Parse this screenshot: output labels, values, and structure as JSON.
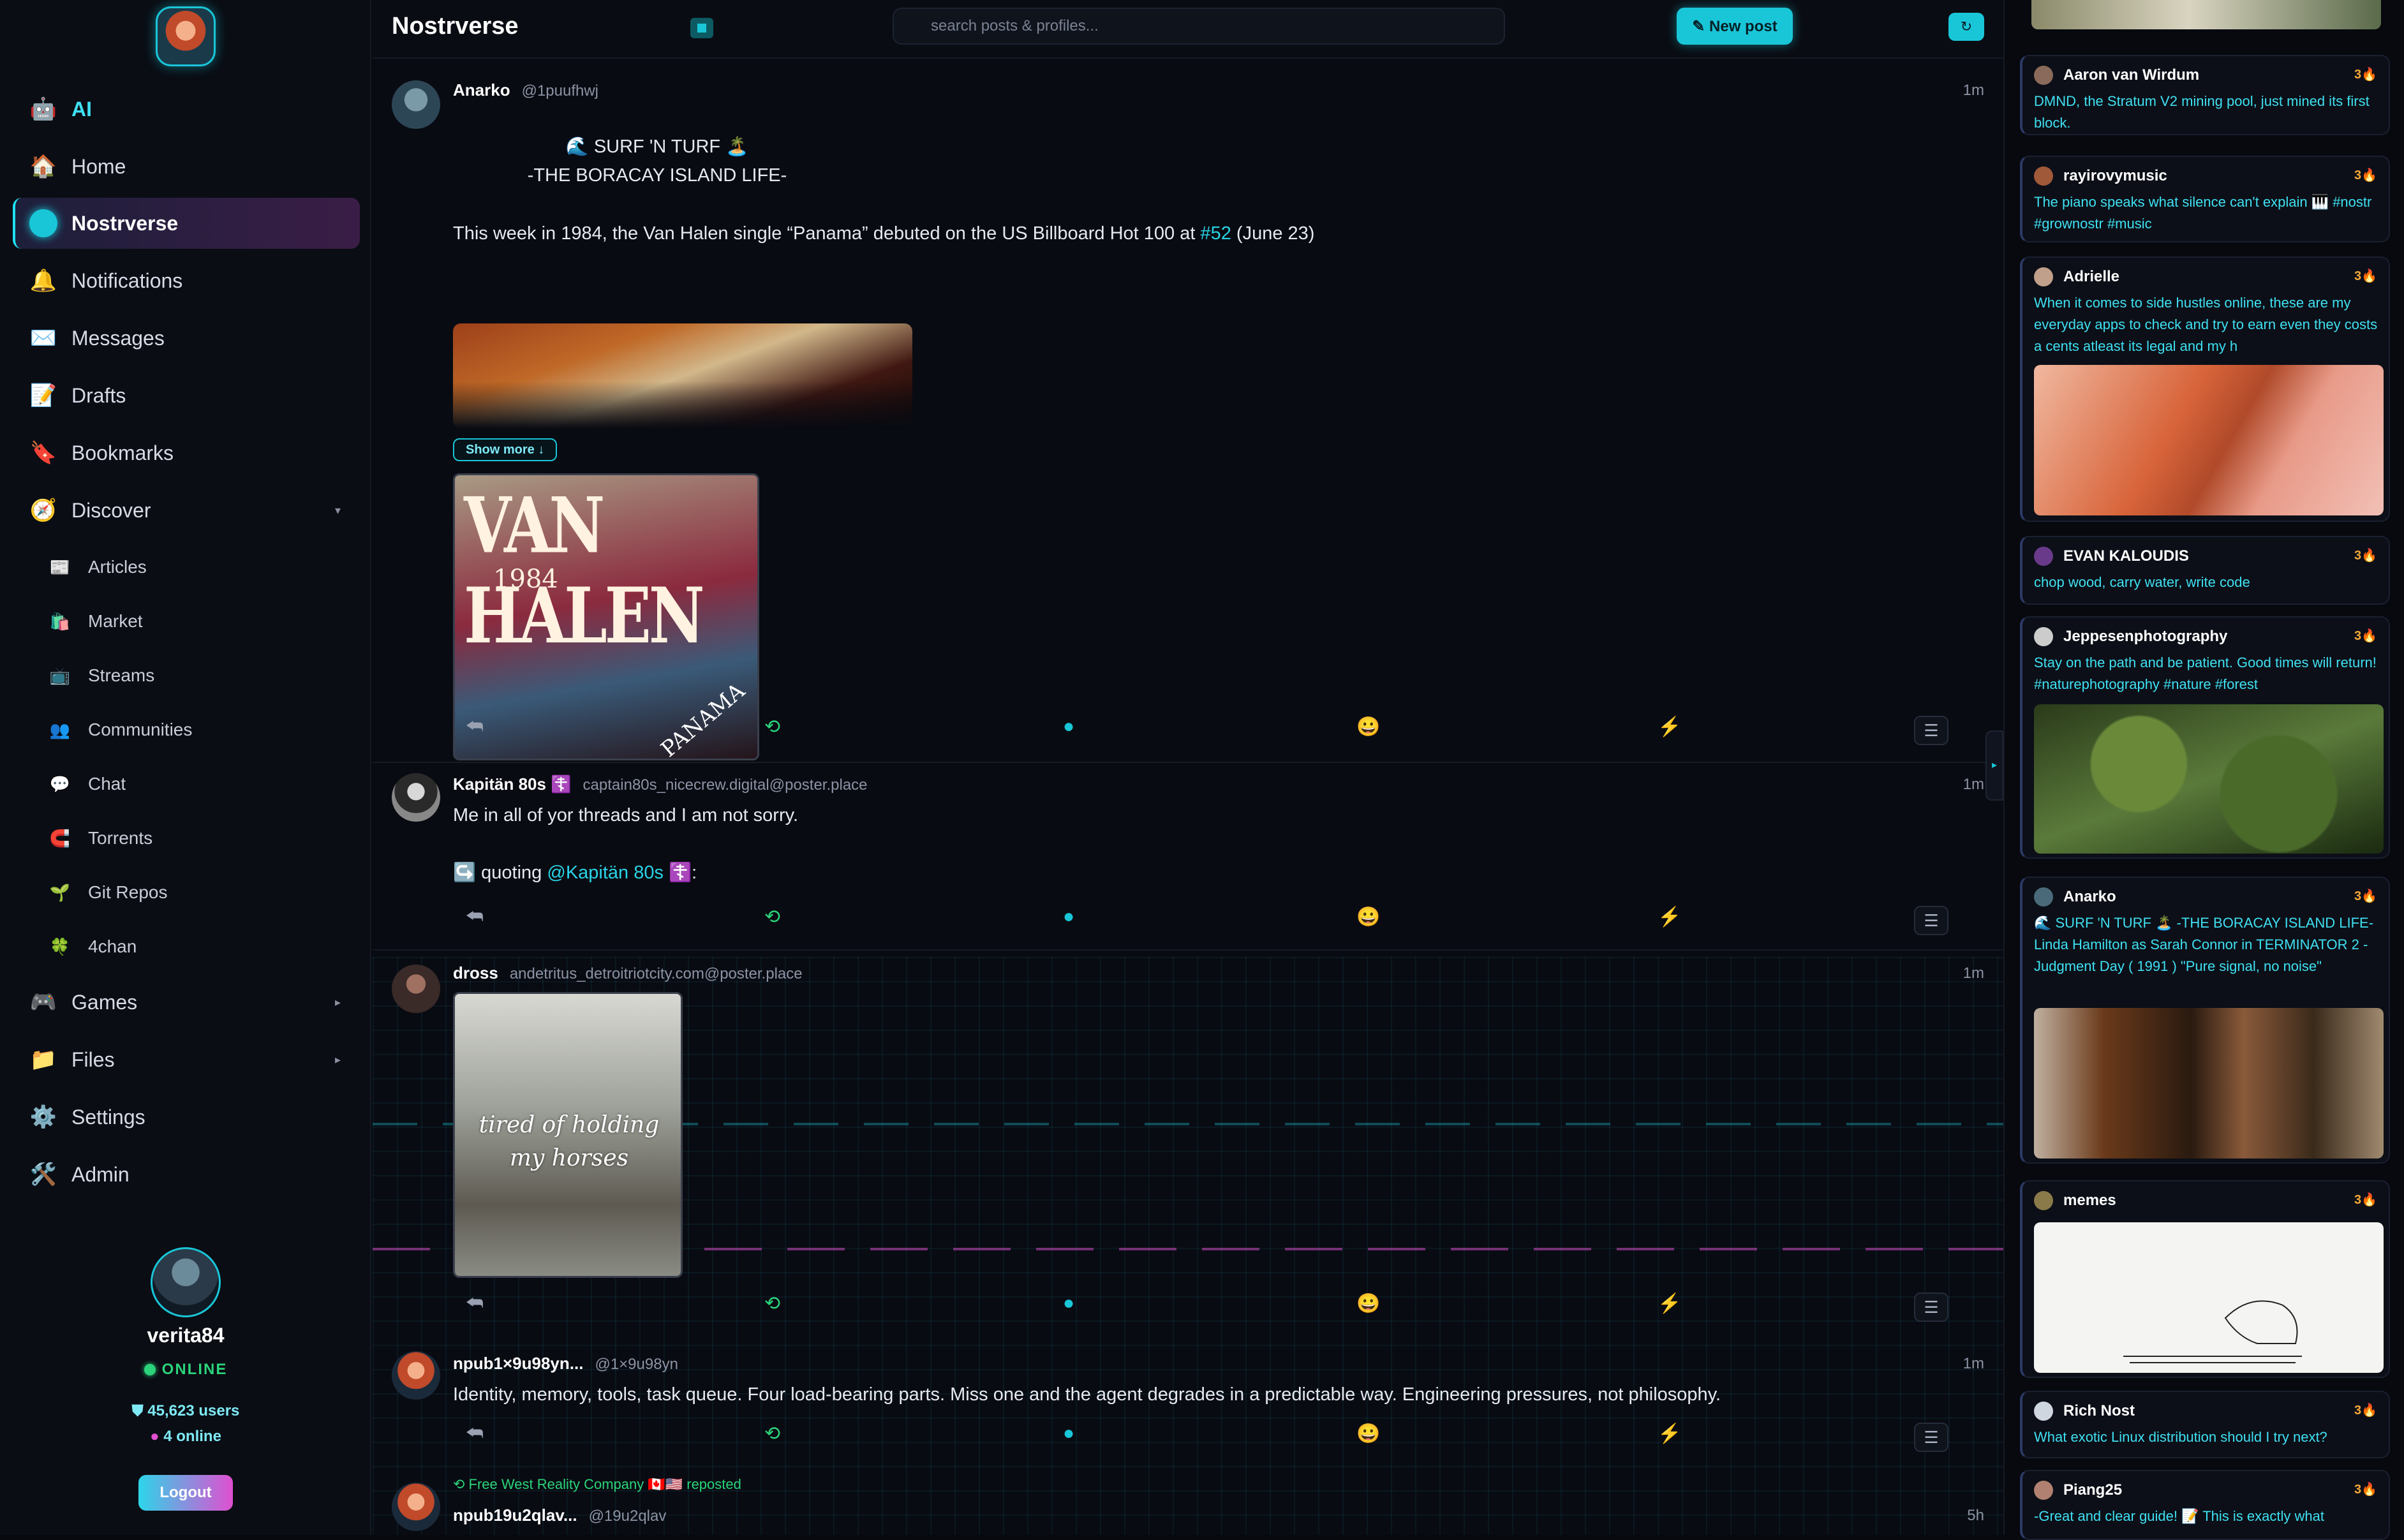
{
  "sidebar": {
    "nav": [
      {
        "icon": "robot-icon",
        "glyph": "🤖",
        "label": "AI"
      },
      {
        "icon": "home-icon",
        "glyph": "🏠",
        "label": "Home"
      },
      {
        "icon": "globe-icon",
        "glyph": "",
        "label": "Nostrverse"
      },
      {
        "icon": "bell-icon",
        "glyph": "🔔",
        "label": "Notifications"
      },
      {
        "icon": "envelope-icon",
        "glyph": "✉️",
        "label": "Messages"
      },
      {
        "icon": "memo-icon",
        "glyph": "📝",
        "label": "Drafts"
      },
      {
        "icon": "bookmark-icon",
        "glyph": "🔖",
        "label": "Bookmarks"
      },
      {
        "icon": "compass-icon",
        "glyph": "🧭",
        "label": "Discover"
      }
    ],
    "discover_items": [
      {
        "icon": "newspaper-icon",
        "glyph": "📰",
        "label": "Articles"
      },
      {
        "icon": "shopping-bags-icon",
        "glyph": "🛍️",
        "label": "Market"
      },
      {
        "icon": "tv-icon",
        "glyph": "📺",
        "label": "Streams"
      },
      {
        "icon": "people-icon",
        "glyph": "👥",
        "label": "Communities"
      },
      {
        "icon": "speech-bubble-icon",
        "glyph": "💬",
        "label": "Chat"
      },
      {
        "icon": "magnet-icon",
        "glyph": "🧲",
        "label": "Torrents"
      },
      {
        "icon": "seedling-icon",
        "glyph": "🌱",
        "label": "Git Repos"
      },
      {
        "icon": "clover-icon",
        "glyph": "🍀",
        "label": "4chan"
      }
    ],
    "nav_bottom": [
      {
        "icon": "gamepad-icon",
        "glyph": "🎮",
        "label": "Games"
      },
      {
        "icon": "folder-icon",
        "glyph": "📁",
        "label": "Files"
      },
      {
        "icon": "gear-icon",
        "glyph": "⚙️",
        "label": "Settings"
      },
      {
        "icon": "tools-icon",
        "glyph": "🛠️",
        "label": "Admin"
      }
    ],
    "user": {
      "name": "verita84",
      "status": "ONLINE",
      "users": "45,623 users",
      "online": "4 online",
      "logout": "Logout"
    }
  },
  "topbar": {
    "title": "Nostrverse",
    "search_placeholder": "search posts & profiles...",
    "new_post": "✎ New post",
    "refresh": "↻"
  },
  "posts": [
    {
      "name": "Anarko",
      "handle": "@1puufhwj",
      "time": "1m",
      "line1": "🌊 SURF 'N TURF 🏝️",
      "line2": "-THE BORACAY ISLAND LIFE-",
      "line3_pre": "This week in 1984, the Van Halen single “Panama” debuted on the US Billboard Hot 100 at ",
      "line3_tag": "#52",
      "line3_post": " (June 23)",
      "show_more": "Show more ↓",
      "album_title": "VAN HALEN",
      "album_year": "1984",
      "album_stamp": "PANAMA"
    },
    {
      "name": "Kapitän 80s ☦️",
      "handle": "captain80s_nicecrew.digital@poster.place",
      "time": "1m",
      "text": "Me in all of yor threads and I am not sorry.",
      "quote_pre": "↪️ quoting ",
      "quote_tag": "@Kapitän 80s ☦️",
      "quote_post": ":"
    },
    {
      "name": "dross",
      "handle": "andetritus_detroitriotcity.com@poster.place",
      "time": "1m",
      "image_caption": "tired of holding my horses"
    },
    {
      "name": "npub1×9u98yn...",
      "handle": "@1×9u98yn",
      "time": "1m",
      "text": "Identity, memory, tools, task queue. Four load-bearing parts. Miss one and the agent degrades in a predictable way. Engineering pressures, not philosophy."
    },
    {
      "repost_by": "⟲ Free West Reality Company 🇨🇦🇺🇸 reposted",
      "name": "npub19u2qlav...",
      "handle": "@19u2qlav",
      "time": "5h"
    }
  ],
  "actions": {
    "reply": "⮪",
    "repost": "⟲",
    "comment": "●",
    "emoji": "😀",
    "zap": "⚡",
    "menu": "☰"
  },
  "right_feed": [
    {
      "name": "Aaron van Wirdum",
      "score": "3🔥",
      "text": "DMND, the Stratum V2 mining pool, just mined its first block."
    },
    {
      "name": "rayirovymusic",
      "score": "3🔥",
      "text": "The piano speaks what silence can't explain 🎹 #nostr #grownostr #music"
    },
    {
      "name": "Adrielle",
      "score": "3🔥",
      "text": "When it comes to side hustles online, these are my everyday apps to check and try to earn even they costs a cents atleast its legal and my h"
    },
    {
      "name": "EVAN KALOUDIS",
      "score": "3🔥",
      "text": "chop wood, carry water, write code"
    },
    {
      "name": "Jeppesenphotography",
      "score": "3🔥",
      "text": "Stay on the path and be patient. Good times will return! #naturephotography #nature #forest"
    },
    {
      "name": "Anarko",
      "score": "3🔥",
      "text": "🌊 SURF 'N TURF 🏝️ -THE BORACAY ISLAND LIFE- Linda Hamilton as Sarah Connor in TERMINATOR 2 - Judgment Day ( 1991 ) \"Pure signal, no noise\""
    },
    {
      "name": "memes",
      "score": "3🔥",
      "text": ""
    },
    {
      "name": "Rich Nost",
      "score": "3🔥",
      "text": "What exotic Linux distribution should I try next?"
    },
    {
      "name": "Piang25",
      "score": "3🔥",
      "text": "-Great and clear guide! 📝 This is exactly what"
    }
  ],
  "colors": {
    "accent": "#19c6d8",
    "online": "#2bd47a",
    "magenta": "#e04fd0",
    "zap": "#f4c430"
  }
}
